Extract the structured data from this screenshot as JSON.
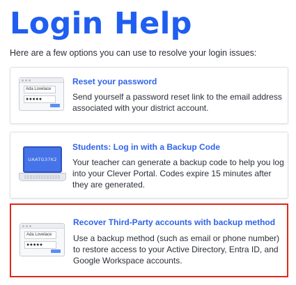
{
  "page": {
    "title": "Login Help",
    "intro": "Here are a few options you can use to resolve your login issues:"
  },
  "cards": [
    {
      "link": "Reset your password",
      "description": "Send yourself a password reset link to the email address associated with your district account.",
      "illustration": {
        "type": "login-window",
        "name": "Ada Lovelace",
        "password_mask": "●●●●●"
      }
    },
    {
      "link": "Students: Log in with a Backup Code",
      "description": "Your teacher can generate a backup code to help you log into your Clever Portal. Codes expire 15 minutes after they are generated.",
      "illustration": {
        "type": "laptop",
        "code": "UAATG37K2"
      }
    },
    {
      "link": "Recover Third-Party accounts with backup method",
      "description": "Use a backup method (such as email or phone number) to restore access to your Active Directory, Entra ID, and Google Workspace accounts.",
      "illustration": {
        "type": "login-window",
        "name": "Ada Lovelace",
        "password_mask": "●●●●●"
      },
      "highlighted": true
    }
  ],
  "colors": {
    "title": "#1f5ef0",
    "link": "#2f63e8",
    "highlight_border": "#e0271b"
  }
}
